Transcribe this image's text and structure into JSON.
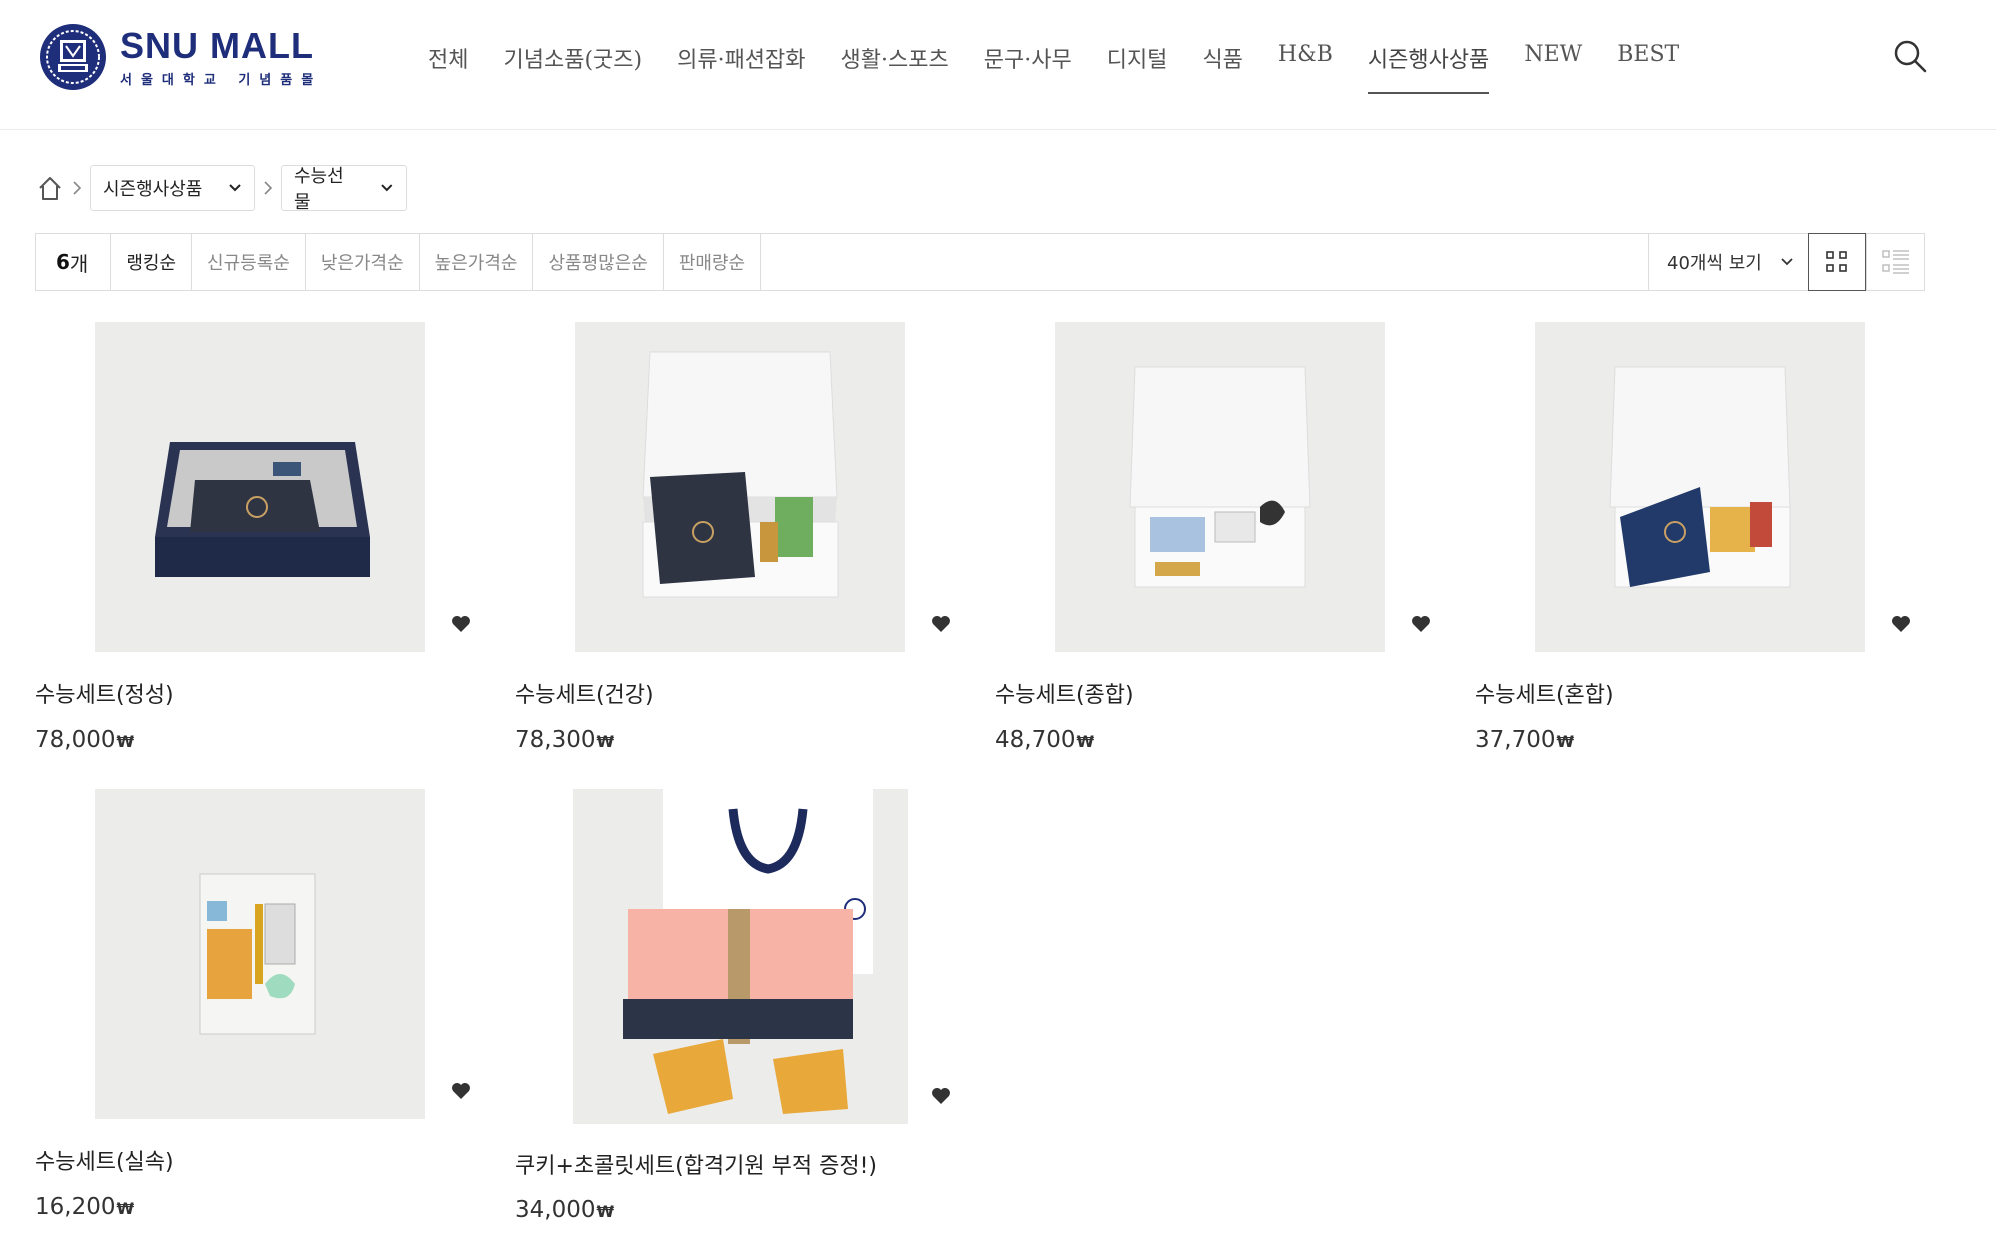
{
  "brand": {
    "title": "SNU MALL",
    "subtitle": "서울대학교 기념품몰"
  },
  "nav": {
    "items": [
      {
        "label": "전체"
      },
      {
        "label": "기념소품(굿즈)"
      },
      {
        "label": "의류·패션잡화"
      },
      {
        "label": "생활·스포츠"
      },
      {
        "label": "문구·사무"
      },
      {
        "label": "디지털"
      },
      {
        "label": "식품"
      },
      {
        "label": "H&B"
      },
      {
        "label": "시즌행사상품",
        "active": true
      },
      {
        "label": "NEW"
      },
      {
        "label": "BEST"
      }
    ],
    "search_icon": "search-icon"
  },
  "breadcrumb": {
    "home_icon": "home-icon",
    "category": "시즌행사상품",
    "subcategory": "수능선물"
  },
  "sortbar": {
    "count": "6",
    "count_unit": "개",
    "options": [
      "랭킹순",
      "신규등록순",
      "낮은가격순",
      "높은가격순",
      "상품평많은순",
      "판매량순"
    ],
    "active_option": "랭킹순",
    "per_page": "40개씩 보기",
    "view_modes": [
      "grid-view-icon",
      "list-view-icon"
    ],
    "active_view": "grid-view-icon"
  },
  "products": [
    {
      "name": "수능세트(정성)",
      "price": "78,000",
      "currency": "₩"
    },
    {
      "name": "수능세트(건강)",
      "price": "78,300",
      "currency": "₩"
    },
    {
      "name": "수능세트(종합)",
      "price": "48,700",
      "currency": "₩"
    },
    {
      "name": "수능세트(혼합)",
      "price": "37,700",
      "currency": "₩"
    },
    {
      "name": "수능세트(실속)",
      "price": "16,200",
      "currency": "₩"
    },
    {
      "name": "쿠키+초콜릿세트(합격기원 부적 증정!)",
      "price": "34,000",
      "currency": "₩"
    }
  ],
  "colors": {
    "brand_navy": "#1f2e7a",
    "text": "#222222",
    "muted": "#888888",
    "border": "#dddddd",
    "thumb_bg": "#ececeb"
  }
}
